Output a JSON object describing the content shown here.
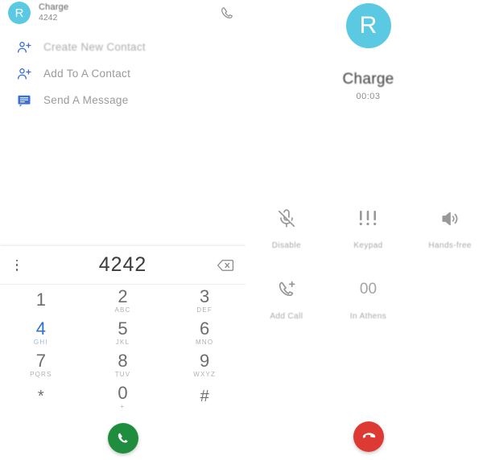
{
  "colors": {
    "avatar_cyan": "#5BC9E1",
    "accent_blue": "#2f6fd0",
    "icon_blue": "#3b6fd4",
    "call_green": "#1E8E3E",
    "end_call_red": "#DC3A32",
    "text_gray": "#6d6d6d",
    "label_gray": "#a9a9a9"
  },
  "left_panel": {
    "contact": {
      "avatar_initial": "R",
      "name": "Charge",
      "number": "4242"
    },
    "header_call_icon": "phone-icon",
    "actions": [
      {
        "icon": "person-add-icon",
        "label": "Create New Contact"
      },
      {
        "icon": "person-add-icon",
        "label": "Add To A Contact"
      },
      {
        "icon": "message-icon",
        "label": "Send A Message"
      }
    ],
    "dialpad": {
      "overflow_icon": "overflow-menu-icon",
      "display_value": "4242",
      "backspace_icon": "backspace-icon",
      "call_icon": "phone-icon",
      "keys": [
        {
          "digit": "1",
          "letters": ""
        },
        {
          "digit": "2",
          "letters": "ABC"
        },
        {
          "digit": "3",
          "letters": "DEF"
        },
        {
          "digit": "4",
          "letters": "GHI",
          "pressed": true
        },
        {
          "digit": "5",
          "letters": "JKL"
        },
        {
          "digit": "6",
          "letters": "MNO"
        },
        {
          "digit": "7",
          "letters": "PQRS"
        },
        {
          "digit": "8",
          "letters": "TUV"
        },
        {
          "digit": "9",
          "letters": "WXYZ"
        },
        {
          "digit": "*",
          "letters": ""
        },
        {
          "digit": "0",
          "letters": "+"
        },
        {
          "digit": "#",
          "letters": ""
        }
      ]
    }
  },
  "right_panel": {
    "avatar_initial": "R",
    "contact_name": "Charge",
    "timer": "00:03",
    "controls": [
      {
        "icon": "mic-off-icon",
        "label": "Disable"
      },
      {
        "icon": "keypad-icon",
        "label": "Keypad"
      },
      {
        "icon": "speaker-icon",
        "label": "Hands-free"
      },
      {
        "icon": "add-call-icon",
        "label": "Add Call"
      },
      {
        "icon": "hold-icon",
        "label": "In Athens",
        "value": "00"
      }
    ],
    "end_call_icon": "end-call-icon"
  }
}
